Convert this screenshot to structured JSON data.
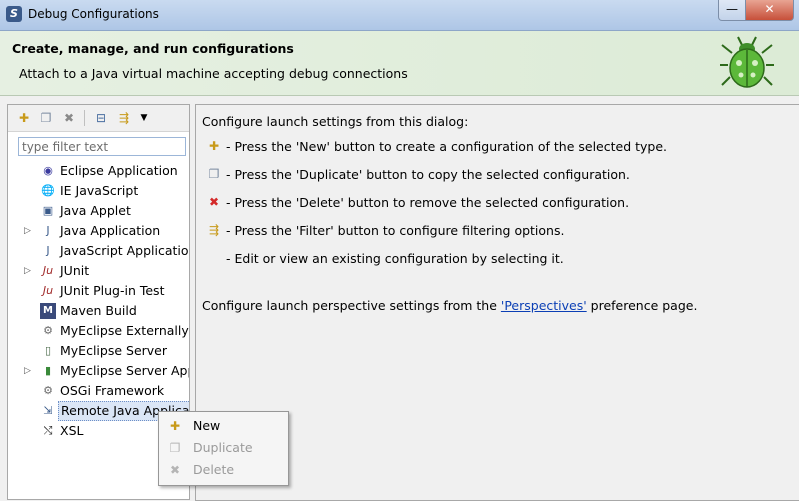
{
  "window": {
    "title": "Debug Configurations",
    "minimize": "—",
    "close": "✕"
  },
  "header": {
    "title": "Create, manage, and run configurations",
    "subtitle": "Attach to a Java virtual machine accepting debug connections"
  },
  "toolbar": {
    "icons": [
      "new-configuration-icon",
      "duplicate-icon",
      "delete-icon",
      "collapse-all-icon",
      "filter-icon",
      "view-menu-icon"
    ]
  },
  "filter": {
    "placeholder": "type filter text",
    "value": ""
  },
  "tree": {
    "items": [
      {
        "label": "Eclipse Application",
        "expandable": false,
        "icon": "eclipse-icon"
      },
      {
        "label": "IE JavaScript",
        "expandable": false,
        "icon": "globe-icon"
      },
      {
        "label": "Java Applet",
        "expandable": false,
        "icon": "applet-icon"
      },
      {
        "label": "Java Application",
        "expandable": true,
        "icon": "java-app-icon"
      },
      {
        "label": "JavaScript Application",
        "expandable": false,
        "icon": "js-icon"
      },
      {
        "label": "JUnit",
        "expandable": true,
        "icon": "junit-icon"
      },
      {
        "label": "JUnit Plug-in Test",
        "expandable": false,
        "icon": "junit-plugin-icon"
      },
      {
        "label": "Maven Build",
        "expandable": false,
        "icon": "maven-icon"
      },
      {
        "label": "MyEclipse Externally L",
        "expandable": false,
        "icon": "myeclipse-icon"
      },
      {
        "label": "MyEclipse Server",
        "expandable": false,
        "icon": "server-icon"
      },
      {
        "label": "MyEclipse Server App",
        "expandable": true,
        "icon": "server-app-icon"
      },
      {
        "label": "OSGi Framework",
        "expandable": false,
        "icon": "osgi-icon"
      },
      {
        "label": "Remote Java Applicat",
        "expandable": false,
        "icon": "remote-java-icon",
        "selected": true
      },
      {
        "label": "XSL",
        "expandable": false,
        "icon": "xsl-icon"
      }
    ]
  },
  "main": {
    "intro": "Configure launch settings from this dialog:",
    "steps": [
      {
        "icon": "new-configuration-icon",
        "text": "- Press the 'New' button to create a configuration of the selected type."
      },
      {
        "icon": "duplicate-icon",
        "text": "- Press the 'Duplicate' button to copy the selected configuration."
      },
      {
        "icon": "delete-icon",
        "text": "- Press the 'Delete' button to remove the selected configuration."
      },
      {
        "icon": "filter-icon",
        "text": "- Press the 'Filter' button to configure filtering options."
      },
      {
        "icon": "",
        "text": "- Edit or view an existing configuration by selecting it."
      }
    ],
    "perspectives_prefix": "Configure launch perspective settings from the ",
    "perspectives_link": "'Perspectives'",
    "perspectives_suffix": " preference page."
  },
  "context_menu": {
    "items": [
      {
        "label": "New",
        "enabled": true,
        "icon": "new-configuration-icon"
      },
      {
        "label": "Duplicate",
        "enabled": false,
        "icon": "duplicate-icon"
      },
      {
        "label": "Delete",
        "enabled": false,
        "icon": "delete-icon"
      }
    ]
  },
  "colors": {
    "header_bg": "#e6f0e2",
    "link": "#0b3fb5",
    "delete_red": "#d42a2a"
  }
}
